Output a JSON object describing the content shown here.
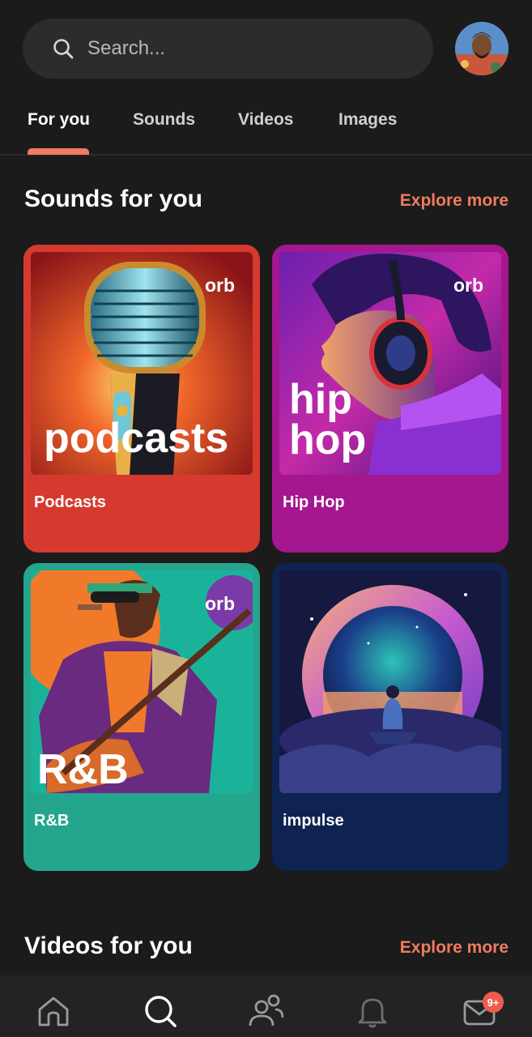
{
  "search": {
    "placeholder": "Search..."
  },
  "tabs": [
    {
      "label": "For you",
      "active": true
    },
    {
      "label": "Sounds",
      "active": false
    },
    {
      "label": "Videos",
      "active": false
    },
    {
      "label": "Images",
      "active": false
    }
  ],
  "sounds_section": {
    "title": "Sounds for you",
    "explore": "Explore more",
    "cards": [
      {
        "label": "Podcasts",
        "art_text": "podcasts",
        "brand": "orb",
        "color": "#d63a2e"
      },
      {
        "label": "Hip Hop",
        "art_text_line1": "hip",
        "art_text_line2": "hop",
        "brand": "orb",
        "color": "#a4178f"
      },
      {
        "label": "R&B",
        "art_text": "R&B",
        "brand": "orb",
        "color": "#23a58e"
      },
      {
        "label": "impulse",
        "color": "#0e2352"
      }
    ]
  },
  "videos_section": {
    "title": "Videos for you",
    "explore": "Explore more"
  },
  "nav": {
    "items": [
      "home-icon",
      "search-icon",
      "community-icon",
      "bell-icon",
      "inbox-icon"
    ],
    "inbox_badge": "9+"
  },
  "colors": {
    "accent": "#f07b5f",
    "background": "#1b1b1b"
  }
}
